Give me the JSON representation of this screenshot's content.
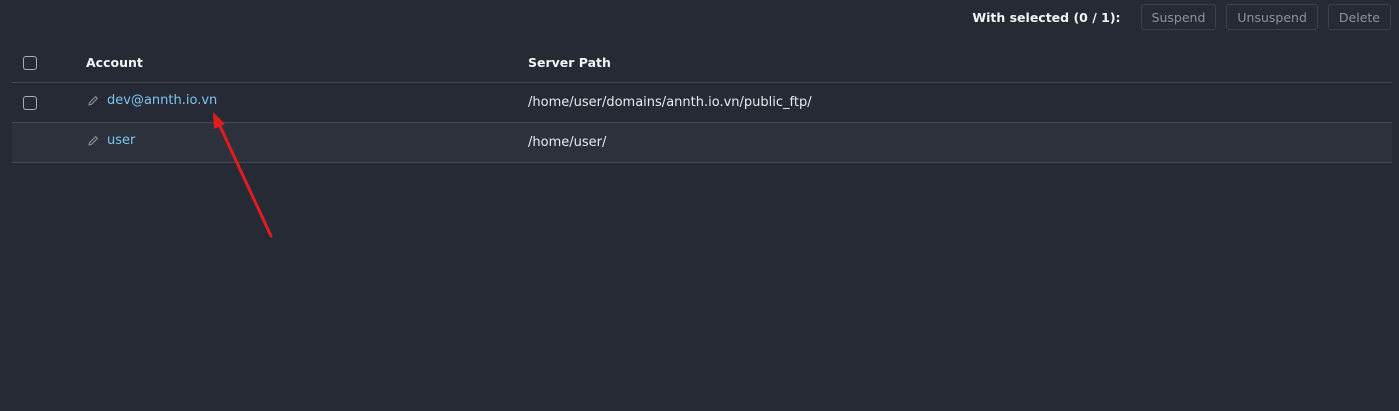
{
  "toolbar": {
    "with_selected": "With selected (0 / 1):",
    "suspend_label": "Suspend",
    "unsuspend_label": "Unsuspend",
    "delete_label": "Delete"
  },
  "table": {
    "headers": {
      "account": "Account",
      "server_path": "Server Path"
    },
    "rows": [
      {
        "account": "dev@annth.io.vn",
        "server_path": "/home/user/domains/annth.io.vn/public_ftp/",
        "has_checkbox": true
      },
      {
        "account": "user",
        "server_path": "/home/user/",
        "has_checkbox": false
      }
    ]
  },
  "icons": {
    "row_edit": "pencil-icon",
    "annotation": "arrow-icon"
  },
  "colors": {
    "background": "#262a34",
    "link": "#7cc4f2",
    "annotation_arrow": "#e21c1c"
  }
}
